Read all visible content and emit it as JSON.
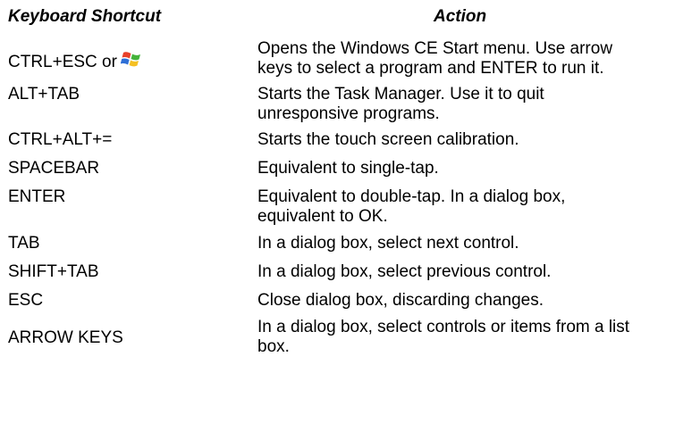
{
  "header": {
    "shortcut_label": "Keyboard Shortcut",
    "action_label": "Action"
  },
  "rows": [
    {
      "key": "CTRL+ESC or",
      "key_icon": "windows-logo-icon",
      "action_lines": [
        "Opens the Windows CE Start menu. Use arrow",
        "keys to select a program and ENTER to run it."
      ]
    },
    {
      "key": "ALT+TAB",
      "action_lines": [
        "Starts the Task Manager. Use it to quit",
        "unresponsive programs."
      ]
    },
    {
      "key": "CTRL+ALT+=",
      "action_lines": [
        "Starts the touch screen calibration."
      ]
    },
    {
      "key": "SPACEBAR",
      "action_lines": [
        "Equivalent to single-tap."
      ]
    },
    {
      "key": "ENTER",
      "action_lines": [
        "Equivalent to double-tap. In a dialog box,",
        "equivalent to OK."
      ]
    },
    {
      "key": "TAB",
      "action_lines": [
        "In a dialog box, select next control."
      ]
    },
    {
      "key": "SHIFT+TAB",
      "action_lines": [
        "In a dialog box, select previous control."
      ]
    },
    {
      "key": "ESC",
      "action_lines": [
        "Close dialog box, discarding changes."
      ]
    },
    {
      "key": "ARROW KEYS",
      "action_lines": [
        "In a dialog box, select controls or items from a list",
        "box."
      ]
    }
  ],
  "colors": {
    "text": "#000000",
    "background": "#ffffff",
    "logo_red": "#e8402a",
    "logo_green": "#45b33a",
    "logo_blue": "#2f6fd6",
    "logo_yellow": "#f5c022"
  }
}
